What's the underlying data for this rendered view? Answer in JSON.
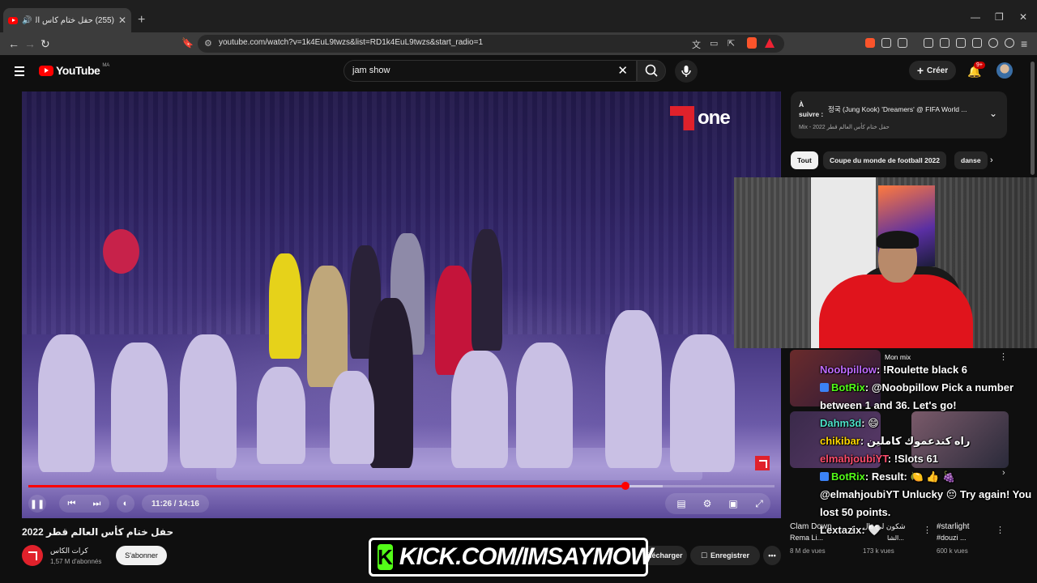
{
  "browser": {
    "tab_title": "(255) حفل ختام كأس العالم قطر",
    "url": "youtube.com/watch?v=1k4EuL9twzs&list=RD1k4EuL9twzs&start_radio=1"
  },
  "masthead": {
    "logo_text": "YouTube",
    "region": "MA",
    "search_value": "jam show",
    "create_label": "Créer",
    "notif_badge": "9+"
  },
  "player": {
    "brand": "one",
    "time": "11:26 / 14:16",
    "progress_fraction": 0.8,
    "buffer_fraction": 0.85
  },
  "video": {
    "title": "حفل ختام كأس العالم قطر 2022",
    "channel": "كرات الكاس",
    "subscribers": "1,57 M d'abonnés",
    "subscribe_label": "S'abonner",
    "download_label": "Télécharger",
    "save_label": "Enregistrer"
  },
  "upnext": {
    "label": "À suivre :",
    "title": "정국 (Jung Kook) 'Dreamers' @ FIFA World ...",
    "meta": "Mix - 2022 حفل ختام كأس العالم قطر"
  },
  "chips": [
    "Tout",
    "Coupe du monde de football 2022",
    "danse"
  ],
  "suggest": {
    "mix_label": "Mon mix",
    "cards": [
      {
        "title": "Clam Down",
        "sub": "Rema Li...",
        "meta": "8 M de vues"
      },
      {
        "title": "شكون لي قال",
        "sub": "الشا...",
        "meta": "173 k vues"
      },
      {
        "title": "#starlight",
        "sub": "#douzi ...",
        "meta": "600 k vues"
      }
    ]
  },
  "chat": [
    {
      "user": "Noobpillow",
      "color": "#c06bff",
      "msg": ": !Roulette black 6"
    },
    {
      "user": "BotRix",
      "color": "#53fc18",
      "msg": ": @Noobpillow Pick a number between 1 and 36. Let's go!",
      "bot": true
    },
    {
      "user": "Dahm3d",
      "color": "#4de0c8",
      "msg": ": 😄"
    },
    {
      "user": "chikibar",
      "color": "#ffd700",
      "msg": ": راه كندعموك كاملين"
    },
    {
      "user": "elmahjoubiYT",
      "color": "#ff4d6d",
      "msg": ": !Slots 61"
    },
    {
      "user": "BotRix",
      "color": "#53fc18",
      "msg": ": Result: 🍋 👍 🍇 @elmahjoubiYT Unlucky 😔 Try again! You lost 50 points.",
      "bot": true
    },
    {
      "user": "Lextazix",
      "color": "#f0f0f0",
      "msg": ": 🤍"
    }
  ],
  "overlay": {
    "kick_letter": "K",
    "kick_text": "KICK.COM/IMSAYMOW"
  }
}
